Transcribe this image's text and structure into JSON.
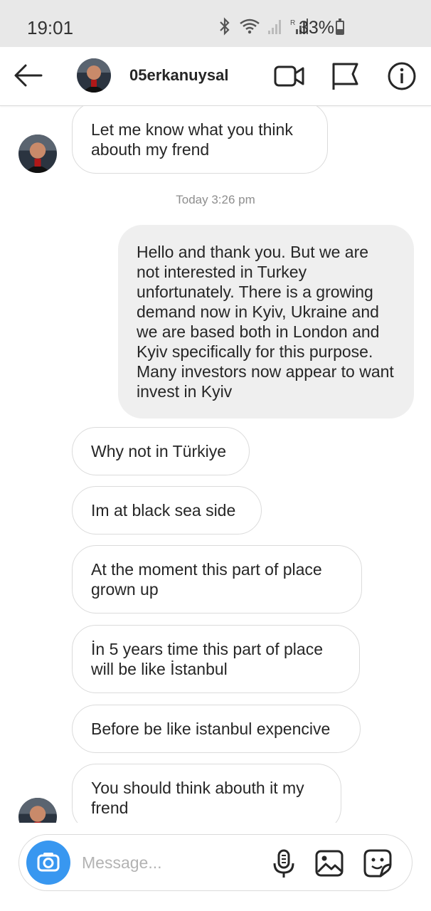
{
  "status_bar": {
    "time": "19:01",
    "battery": "33%",
    "icons": [
      "bluetooth-icon",
      "wifi-icon",
      "signal-icon",
      "signal-r-icon",
      "battery-icon"
    ]
  },
  "header": {
    "username": "05erkanuysal",
    "icons": [
      "back-arrow-icon",
      "video-call-icon",
      "flag-icon",
      "info-icon"
    ]
  },
  "messages": {
    "m1": "Let me know what you think abouth my frend",
    "timestamp": "Today 3:26 pm",
    "m2": "Hello and thank you.  But we are not interested in Turkey unfortunately. There is a growing demand now in Kyiv, Ukraine and we are based both in London and Kyiv specifically for this purpose. Many investors now appear to want invest in Kyiv",
    "m3": "Why not in Türkiye",
    "m4": "Im at black sea side",
    "m5": "At the moment this part of place grown up",
    "m6": "İn 5 years time this part of place will be like İstanbul",
    "m7": "Before be like istanbul expencive",
    "m8": "You should think abouth it my frend"
  },
  "composer": {
    "placeholder": "Message...",
    "icons": [
      "camera-icon",
      "microphone-icon",
      "gallery-icon",
      "sticker-icon"
    ]
  },
  "colors": {
    "accent": "#3897f0",
    "outgoing_bubble": "#efefef",
    "incoming_border": "#dbdbdb",
    "status_bar": "#e8e8e8"
  }
}
